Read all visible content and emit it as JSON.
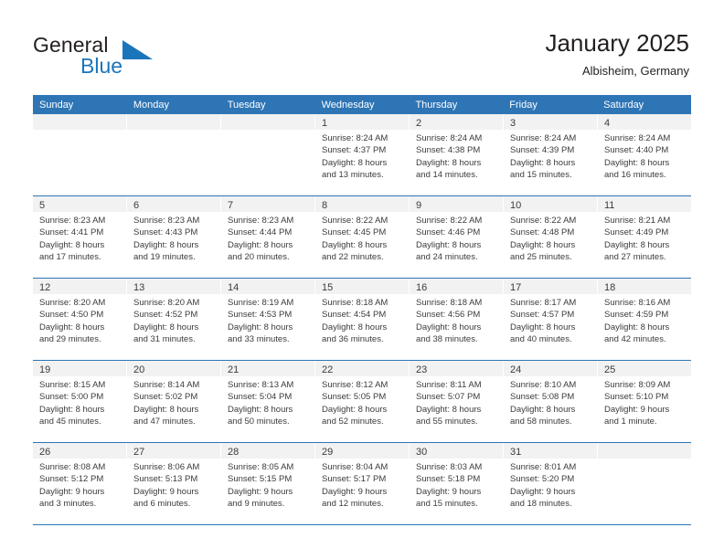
{
  "brand": {
    "name_part1": "General",
    "name_part2": "Blue",
    "logo_icon": "blue-triangle-flag-icon"
  },
  "header": {
    "title": "January 2025",
    "location": "Albisheim, Germany"
  },
  "colors": {
    "header_blue": "#2e75b6",
    "brand_blue": "#1b75bb",
    "day_band_gray": "#f2f2f2",
    "text": "#3b3b3b"
  },
  "weekdays": [
    "Sunday",
    "Monday",
    "Tuesday",
    "Wednesday",
    "Thursday",
    "Friday",
    "Saturday"
  ],
  "weeks": [
    [
      {
        "day": "",
        "lines": []
      },
      {
        "day": "",
        "lines": []
      },
      {
        "day": "",
        "lines": []
      },
      {
        "day": "1",
        "lines": [
          "Sunrise: 8:24 AM",
          "Sunset: 4:37 PM",
          "Daylight: 8 hours",
          "and 13 minutes."
        ]
      },
      {
        "day": "2",
        "lines": [
          "Sunrise: 8:24 AM",
          "Sunset: 4:38 PM",
          "Daylight: 8 hours",
          "and 14 minutes."
        ]
      },
      {
        "day": "3",
        "lines": [
          "Sunrise: 8:24 AM",
          "Sunset: 4:39 PM",
          "Daylight: 8 hours",
          "and 15 minutes."
        ]
      },
      {
        "day": "4",
        "lines": [
          "Sunrise: 8:24 AM",
          "Sunset: 4:40 PM",
          "Daylight: 8 hours",
          "and 16 minutes."
        ]
      }
    ],
    [
      {
        "day": "5",
        "lines": [
          "Sunrise: 8:23 AM",
          "Sunset: 4:41 PM",
          "Daylight: 8 hours",
          "and 17 minutes."
        ]
      },
      {
        "day": "6",
        "lines": [
          "Sunrise: 8:23 AM",
          "Sunset: 4:43 PM",
          "Daylight: 8 hours",
          "and 19 minutes."
        ]
      },
      {
        "day": "7",
        "lines": [
          "Sunrise: 8:23 AM",
          "Sunset: 4:44 PM",
          "Daylight: 8 hours",
          "and 20 minutes."
        ]
      },
      {
        "day": "8",
        "lines": [
          "Sunrise: 8:22 AM",
          "Sunset: 4:45 PM",
          "Daylight: 8 hours",
          "and 22 minutes."
        ]
      },
      {
        "day": "9",
        "lines": [
          "Sunrise: 8:22 AM",
          "Sunset: 4:46 PM",
          "Daylight: 8 hours",
          "and 24 minutes."
        ]
      },
      {
        "day": "10",
        "lines": [
          "Sunrise: 8:22 AM",
          "Sunset: 4:48 PM",
          "Daylight: 8 hours",
          "and 25 minutes."
        ]
      },
      {
        "day": "11",
        "lines": [
          "Sunrise: 8:21 AM",
          "Sunset: 4:49 PM",
          "Daylight: 8 hours",
          "and 27 minutes."
        ]
      }
    ],
    [
      {
        "day": "12",
        "lines": [
          "Sunrise: 8:20 AM",
          "Sunset: 4:50 PM",
          "Daylight: 8 hours",
          "and 29 minutes."
        ]
      },
      {
        "day": "13",
        "lines": [
          "Sunrise: 8:20 AM",
          "Sunset: 4:52 PM",
          "Daylight: 8 hours",
          "and 31 minutes."
        ]
      },
      {
        "day": "14",
        "lines": [
          "Sunrise: 8:19 AM",
          "Sunset: 4:53 PM",
          "Daylight: 8 hours",
          "and 33 minutes."
        ]
      },
      {
        "day": "15",
        "lines": [
          "Sunrise: 8:18 AM",
          "Sunset: 4:54 PM",
          "Daylight: 8 hours",
          "and 36 minutes."
        ]
      },
      {
        "day": "16",
        "lines": [
          "Sunrise: 8:18 AM",
          "Sunset: 4:56 PM",
          "Daylight: 8 hours",
          "and 38 minutes."
        ]
      },
      {
        "day": "17",
        "lines": [
          "Sunrise: 8:17 AM",
          "Sunset: 4:57 PM",
          "Daylight: 8 hours",
          "and 40 minutes."
        ]
      },
      {
        "day": "18",
        "lines": [
          "Sunrise: 8:16 AM",
          "Sunset: 4:59 PM",
          "Daylight: 8 hours",
          "and 42 minutes."
        ]
      }
    ],
    [
      {
        "day": "19",
        "lines": [
          "Sunrise: 8:15 AM",
          "Sunset: 5:00 PM",
          "Daylight: 8 hours",
          "and 45 minutes."
        ]
      },
      {
        "day": "20",
        "lines": [
          "Sunrise: 8:14 AM",
          "Sunset: 5:02 PM",
          "Daylight: 8 hours",
          "and 47 minutes."
        ]
      },
      {
        "day": "21",
        "lines": [
          "Sunrise: 8:13 AM",
          "Sunset: 5:04 PM",
          "Daylight: 8 hours",
          "and 50 minutes."
        ]
      },
      {
        "day": "22",
        "lines": [
          "Sunrise: 8:12 AM",
          "Sunset: 5:05 PM",
          "Daylight: 8 hours",
          "and 52 minutes."
        ]
      },
      {
        "day": "23",
        "lines": [
          "Sunrise: 8:11 AM",
          "Sunset: 5:07 PM",
          "Daylight: 8 hours",
          "and 55 minutes."
        ]
      },
      {
        "day": "24",
        "lines": [
          "Sunrise: 8:10 AM",
          "Sunset: 5:08 PM",
          "Daylight: 8 hours",
          "and 58 minutes."
        ]
      },
      {
        "day": "25",
        "lines": [
          "Sunrise: 8:09 AM",
          "Sunset: 5:10 PM",
          "Daylight: 9 hours",
          "and 1 minute."
        ]
      }
    ],
    [
      {
        "day": "26",
        "lines": [
          "Sunrise: 8:08 AM",
          "Sunset: 5:12 PM",
          "Daylight: 9 hours",
          "and 3 minutes."
        ]
      },
      {
        "day": "27",
        "lines": [
          "Sunrise: 8:06 AM",
          "Sunset: 5:13 PM",
          "Daylight: 9 hours",
          "and 6 minutes."
        ]
      },
      {
        "day": "28",
        "lines": [
          "Sunrise: 8:05 AM",
          "Sunset: 5:15 PM",
          "Daylight: 9 hours",
          "and 9 minutes."
        ]
      },
      {
        "day": "29",
        "lines": [
          "Sunrise: 8:04 AM",
          "Sunset: 5:17 PM",
          "Daylight: 9 hours",
          "and 12 minutes."
        ]
      },
      {
        "day": "30",
        "lines": [
          "Sunrise: 8:03 AM",
          "Sunset: 5:18 PM",
          "Daylight: 9 hours",
          "and 15 minutes."
        ]
      },
      {
        "day": "31",
        "lines": [
          "Sunrise: 8:01 AM",
          "Sunset: 5:20 PM",
          "Daylight: 9 hours",
          "and 18 minutes."
        ]
      },
      {
        "day": "",
        "lines": []
      }
    ]
  ]
}
